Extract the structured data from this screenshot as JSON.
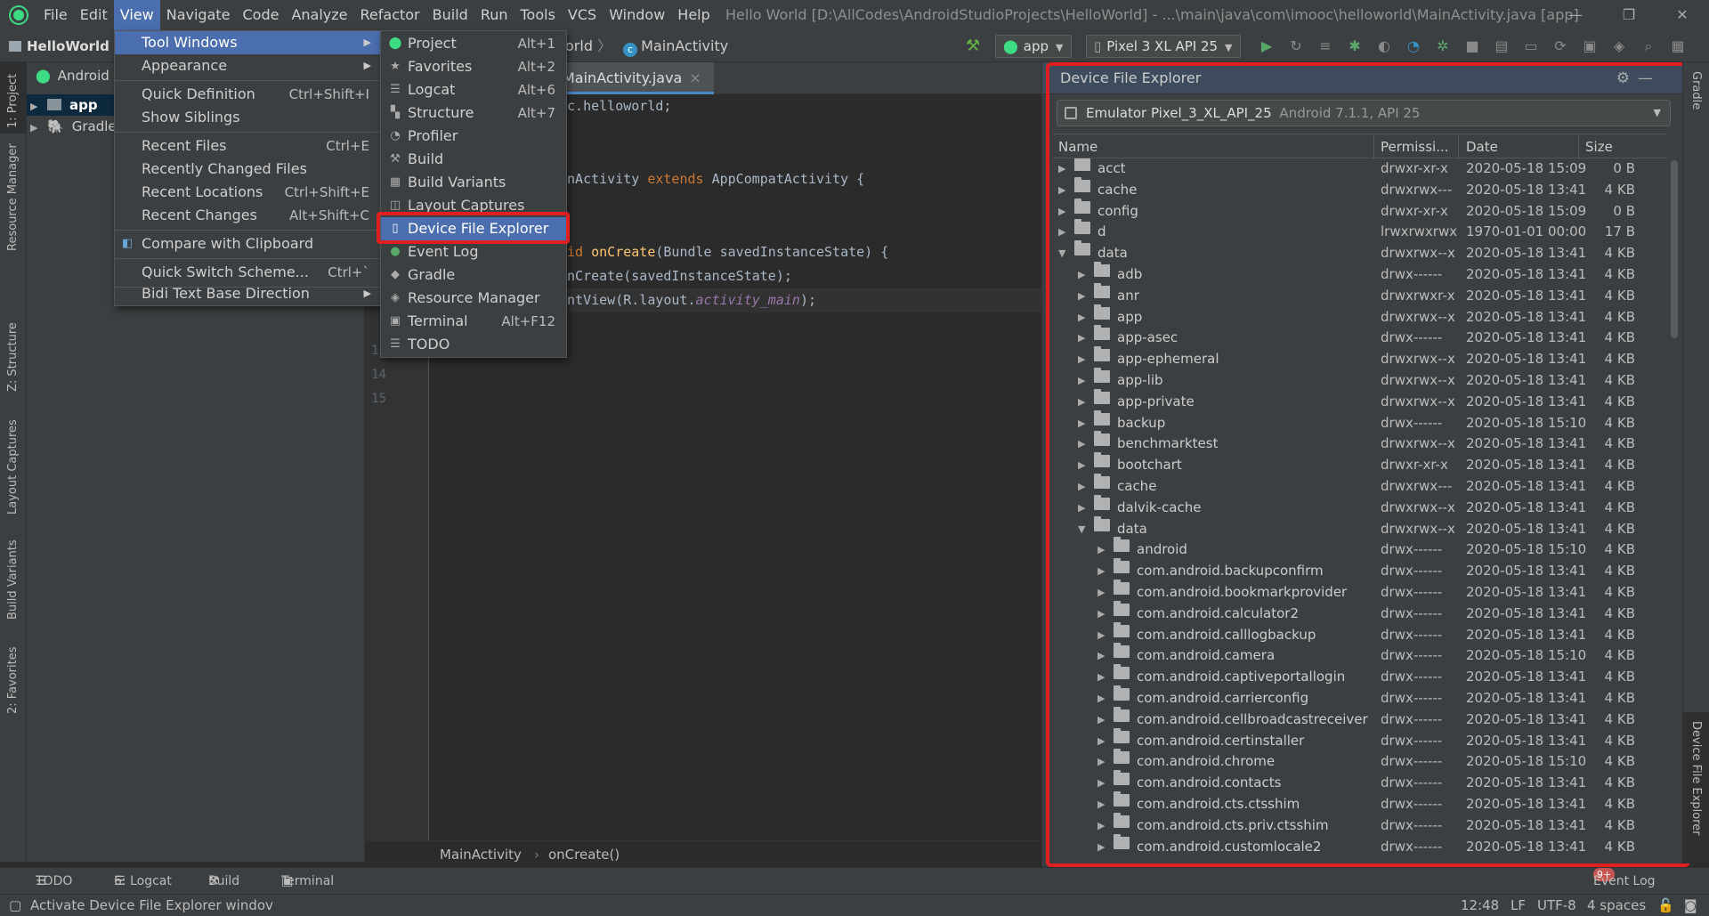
{
  "menubar": {
    "items": [
      "File",
      "Edit",
      "View",
      "Navigate",
      "Code",
      "Analyze",
      "Refactor",
      "Build",
      "Run",
      "Tools",
      "VCS",
      "Window",
      "Help"
    ],
    "active": "View",
    "title": "Hello World [D:\\AllCodes\\AndroidStudioProjects\\HelloWorld] - ...\\main\\java\\com\\imooc\\helloworld\\MainActivity.java [app]",
    "window_controls": [
      "—",
      "❐",
      "✕"
    ]
  },
  "navbar": {
    "project": "HelloWorld",
    "crumb_partial": "orld",
    "crumb_class": "MainActivity",
    "run_config": "app",
    "device": "Pixel 3 XL API 25"
  },
  "left_strip": {
    "tabs": [
      "1: Project",
      "Resource Manager",
      "Z: Structure",
      "Layout Captures",
      "Build Variants",
      "2: Favorites"
    ]
  },
  "right_strip": {
    "tabs": [
      "Gradle",
      "Device File Explorer"
    ]
  },
  "project_panel": {
    "view_label": "Android",
    "rows": [
      {
        "label": "app",
        "selected": true
      },
      {
        "label": "Gradle",
        "selected": false
      }
    ]
  },
  "editor": {
    "tab": "MainActivity.java",
    "line_numbers": [
      "1",
      "13",
      "14",
      "15"
    ],
    "lines": [
      {
        "pre": "",
        "kw": "",
        "text": "oc.helloworld;"
      },
      {
        "pre": "",
        "kw": "",
        "text": "inActivity "
      },
      {
        "pre": "",
        "kw": "",
        "text": "oid "
      },
      {
        "pre": "",
        "kw": "",
        "text": "onCreate(savedInstanceState);"
      },
      {
        "pre": "",
        "kw": "",
        "text": "entView(R.layout."
      },
      {
        "pre": "",
        "kw": "",
        "text": "}"
      },
      {
        "pre": "",
        "kw": "",
        "text": "}"
      }
    ],
    "code": {
      "l1": "oc.helloworld;",
      "l2a": "inActivity ",
      "l2kw": "extends",
      "l2b": " AppCompatActivity {",
      "l3kw": "oid ",
      "l3fn": "onCreate",
      "l3b": "(Bundle savedInstanceState) {",
      "l4": "onCreate(savedInstanceState);",
      "l5a": "entView(R.layout.",
      "l5it": "activity_main",
      "l5b": ");",
      "l6": "}",
      "l7": "}"
    },
    "breadcrumb": [
      "MainActivity",
      "onCreate()"
    ]
  },
  "view_menu": {
    "items": [
      {
        "label": "Tool Windows",
        "shortcut": "",
        "submenu": true,
        "selected": true
      },
      {
        "label": "Appearance",
        "shortcut": "",
        "submenu": true
      },
      {
        "label": "Quick Definition",
        "shortcut": "Ctrl+Shift+I"
      },
      {
        "label": "Show Siblings",
        "shortcut": ""
      },
      {
        "label": "Recent Files",
        "shortcut": "Ctrl+E"
      },
      {
        "label": "Recently Changed Files",
        "shortcut": ""
      },
      {
        "label": "Recent Locations",
        "shortcut": "Ctrl+Shift+E"
      },
      {
        "label": "Recent Changes",
        "shortcut": "Alt+Shift+C"
      },
      {
        "label": "Compare with Clipboard",
        "shortcut": ""
      },
      {
        "label": "Quick Switch Scheme...",
        "shortcut": "Ctrl+`"
      },
      {
        "label": "Bidi Text Base Direction",
        "shortcut": "",
        "submenu": true
      }
    ]
  },
  "tool_windows_menu": {
    "items": [
      {
        "label": "Project",
        "shortcut": "Alt+1",
        "icon": "android-icon"
      },
      {
        "label": "Favorites",
        "shortcut": "Alt+2",
        "icon": "star-icon"
      },
      {
        "label": "Logcat",
        "shortcut": "Alt+6",
        "icon": "logcat-icon"
      },
      {
        "label": "Structure",
        "shortcut": "Alt+7",
        "icon": "structure-icon"
      },
      {
        "label": "Profiler",
        "shortcut": "",
        "icon": "profiler-icon"
      },
      {
        "label": "Build",
        "shortcut": "",
        "icon": "hammer-icon"
      },
      {
        "label": "Build Variants",
        "shortcut": "",
        "icon": "build-variants-icon"
      },
      {
        "label": "Layout Captures",
        "shortcut": "",
        "icon": "layout-captures-icon"
      },
      {
        "label": "Device File Explorer",
        "shortcut": "",
        "icon": "phone-icon",
        "selected": true
      },
      {
        "label": "Event Log",
        "shortcut": "",
        "icon": "event-log-icon"
      },
      {
        "label": "Gradle",
        "shortcut": "",
        "icon": "gradle-icon"
      },
      {
        "label": "Resource Manager",
        "shortcut": "",
        "icon": "resource-manager-icon"
      },
      {
        "label": "Terminal",
        "shortcut": "Alt+F12",
        "icon": "terminal-icon"
      },
      {
        "label": "TODO",
        "shortcut": "",
        "icon": "todo-icon"
      }
    ]
  },
  "device_file_explorer": {
    "title": "Device File Explorer",
    "device": "Emulator Pixel_3_XL_API_25",
    "device_sub": "Android 7.1.1, API 25",
    "columns": [
      "Name",
      "Permissi...",
      "Date",
      "Size"
    ],
    "rows": [
      {
        "name": "acct",
        "level": 0,
        "expanded": false,
        "perm": "drwxr-xr-x",
        "date": "2020-05-18 15:09",
        "size": "0 B"
      },
      {
        "name": "cache",
        "level": 0,
        "expanded": false,
        "perm": "drwxrwx---",
        "date": "2020-05-18 13:41",
        "size": "4 KB"
      },
      {
        "name": "config",
        "level": 0,
        "expanded": false,
        "perm": "drwxr-xr-x",
        "date": "2020-05-18 15:09",
        "size": "0 B"
      },
      {
        "name": "d",
        "level": 0,
        "expanded": false,
        "perm": "lrwxrwxrwx",
        "date": "1970-01-01 00:00",
        "size": "17 B"
      },
      {
        "name": "data",
        "level": 0,
        "expanded": true,
        "perm": "drwxrwx--x",
        "date": "2020-05-18 13:41",
        "size": "4 KB"
      },
      {
        "name": "adb",
        "level": 1,
        "expanded": false,
        "perm": "drwx------",
        "date": "2020-05-18 13:41",
        "size": "4 KB"
      },
      {
        "name": "anr",
        "level": 1,
        "expanded": false,
        "perm": "drwxrwxr-x",
        "date": "2020-05-18 13:41",
        "size": "4 KB"
      },
      {
        "name": "app",
        "level": 1,
        "expanded": false,
        "perm": "drwxrwx--x",
        "date": "2020-05-18 13:41",
        "size": "4 KB"
      },
      {
        "name": "app-asec",
        "level": 1,
        "expanded": false,
        "perm": "drwx------",
        "date": "2020-05-18 13:41",
        "size": "4 KB"
      },
      {
        "name": "app-ephemeral",
        "level": 1,
        "expanded": false,
        "perm": "drwxrwx--x",
        "date": "2020-05-18 13:41",
        "size": "4 KB"
      },
      {
        "name": "app-lib",
        "level": 1,
        "expanded": false,
        "perm": "drwxrwx--x",
        "date": "2020-05-18 13:41",
        "size": "4 KB"
      },
      {
        "name": "app-private",
        "level": 1,
        "expanded": false,
        "perm": "drwxrwx--x",
        "date": "2020-05-18 13:41",
        "size": "4 KB"
      },
      {
        "name": "backup",
        "level": 1,
        "expanded": false,
        "perm": "drwx------",
        "date": "2020-05-18 15:10",
        "size": "4 KB"
      },
      {
        "name": "benchmarktest",
        "level": 1,
        "expanded": false,
        "perm": "drwxrwx--x",
        "date": "2020-05-18 13:41",
        "size": "4 KB"
      },
      {
        "name": "bootchart",
        "level": 1,
        "expanded": false,
        "perm": "drwxr-xr-x",
        "date": "2020-05-18 13:41",
        "size": "4 KB"
      },
      {
        "name": "cache",
        "level": 1,
        "expanded": false,
        "perm": "drwxrwx---",
        "date": "2020-05-18 13:41",
        "size": "4 KB"
      },
      {
        "name": "dalvik-cache",
        "level": 1,
        "expanded": false,
        "perm": "drwxrwx--x",
        "date": "2020-05-18 13:41",
        "size": "4 KB"
      },
      {
        "name": "data",
        "level": 1,
        "expanded": true,
        "perm": "drwxrwx--x",
        "date": "2020-05-18 13:41",
        "size": "4 KB"
      },
      {
        "name": "android",
        "level": 2,
        "expanded": false,
        "perm": "drwx------",
        "date": "2020-05-18 15:10",
        "size": "4 KB"
      },
      {
        "name": "com.android.backupconfirm",
        "level": 2,
        "expanded": false,
        "perm": "drwx------",
        "date": "2020-05-18 13:41",
        "size": "4 KB"
      },
      {
        "name": "com.android.bookmarkprovider",
        "level": 2,
        "expanded": false,
        "perm": "drwx------",
        "date": "2020-05-18 13:41",
        "size": "4 KB"
      },
      {
        "name": "com.android.calculator2",
        "level": 2,
        "expanded": false,
        "perm": "drwx------",
        "date": "2020-05-18 13:41",
        "size": "4 KB"
      },
      {
        "name": "com.android.calllogbackup",
        "level": 2,
        "expanded": false,
        "perm": "drwx------",
        "date": "2020-05-18 13:41",
        "size": "4 KB"
      },
      {
        "name": "com.android.camera",
        "level": 2,
        "expanded": false,
        "perm": "drwx------",
        "date": "2020-05-18 15:10",
        "size": "4 KB"
      },
      {
        "name": "com.android.captiveportallogin",
        "level": 2,
        "expanded": false,
        "perm": "drwx------",
        "date": "2020-05-18 13:41",
        "size": "4 KB"
      },
      {
        "name": "com.android.carrierconfig",
        "level": 2,
        "expanded": false,
        "perm": "drwx------",
        "date": "2020-05-18 13:41",
        "size": "4 KB"
      },
      {
        "name": "com.android.cellbroadcastreceiver",
        "level": 2,
        "expanded": false,
        "perm": "drwx------",
        "date": "2020-05-18 13:41",
        "size": "4 KB"
      },
      {
        "name": "com.android.certinstaller",
        "level": 2,
        "expanded": false,
        "perm": "drwx------",
        "date": "2020-05-18 13:41",
        "size": "4 KB"
      },
      {
        "name": "com.android.chrome",
        "level": 2,
        "expanded": false,
        "perm": "drwx------",
        "date": "2020-05-18 15:10",
        "size": "4 KB"
      },
      {
        "name": "com.android.contacts",
        "level": 2,
        "expanded": false,
        "perm": "drwx------",
        "date": "2020-05-18 13:41",
        "size": "4 KB"
      },
      {
        "name": "com.android.cts.ctsshim",
        "level": 2,
        "expanded": false,
        "perm": "drwx------",
        "date": "2020-05-18 13:41",
        "size": "4 KB"
      },
      {
        "name": "com.android.cts.priv.ctsshim",
        "level": 2,
        "expanded": false,
        "perm": "drwx------",
        "date": "2020-05-18 13:41",
        "size": "4 KB"
      },
      {
        "name": "com.android.customlocale2",
        "level": 2,
        "expanded": false,
        "perm": "drwx------",
        "date": "2020-05-18 13:41",
        "size": "4 KB"
      }
    ]
  },
  "bottom_tools": {
    "todo": "TODO",
    "logcat": "6: Logcat",
    "build": "Build",
    "terminal": "Terminal",
    "event_log_badge": "9+",
    "event_log": "Event Log"
  },
  "statusbar": {
    "message": "Activate Device File Explorer windov",
    "position": "12:48",
    "line_sep": "LF",
    "encoding": "UTF-8",
    "indent": "4 spaces"
  },
  "colors": {
    "accent": "#4b6eaf",
    "highlight_outline": "#e02020",
    "android_green": "#3ddc84"
  }
}
